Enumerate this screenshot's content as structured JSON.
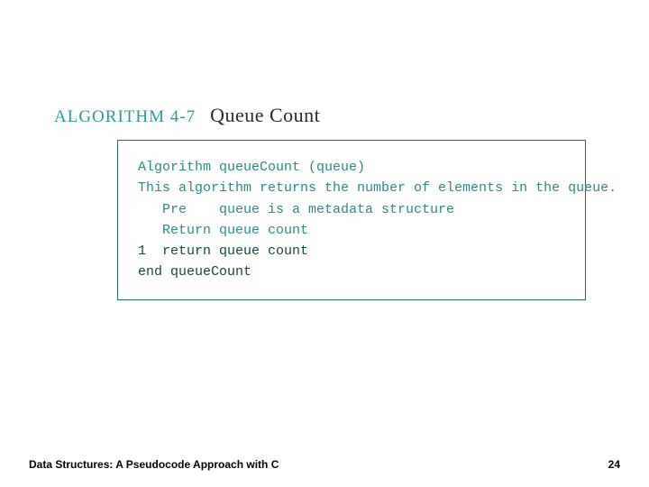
{
  "heading": {
    "label": "ALGORITHM 4-7",
    "title": "Queue Count"
  },
  "algorithm": {
    "lines": [
      {
        "text": "Algorithm queueCount (queue)",
        "style": "teal"
      },
      {
        "text": "This algorithm returns the number of elements in the queue.",
        "style": "teal"
      },
      {
        "text": "   Pre    queue is a metadata structure",
        "style": "teal"
      },
      {
        "text": "   Return queue count",
        "style": "teal"
      },
      {
        "text": "1  return queue count",
        "style": ""
      },
      {
        "text": "end queueCount",
        "style": ""
      }
    ]
  },
  "footer": {
    "text": "Data Structures: A Pseudocode Approach with C",
    "page": "24"
  }
}
